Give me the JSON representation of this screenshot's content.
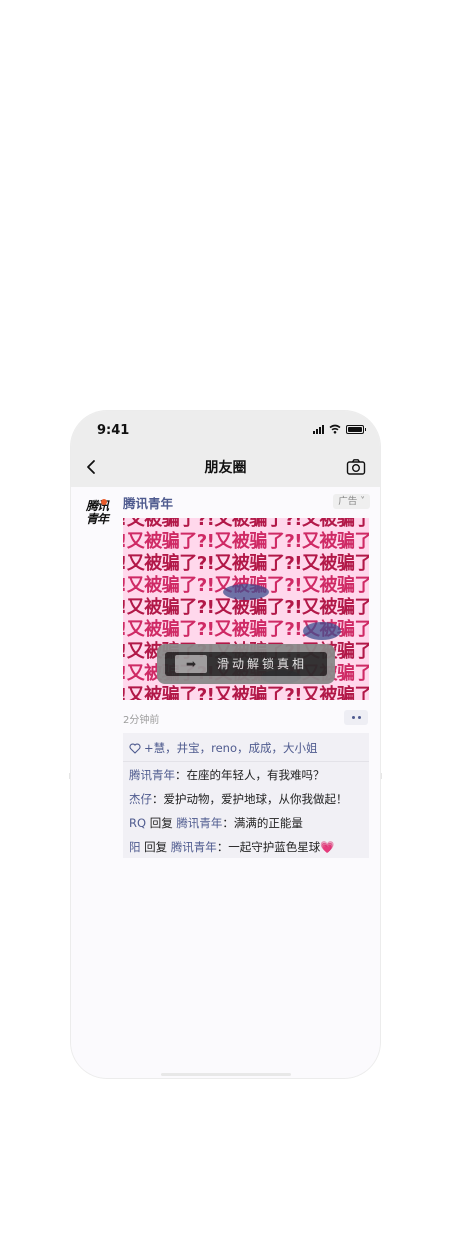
{
  "status_bar": {
    "time": "9:41"
  },
  "navbar": {
    "title": "朋友圈"
  },
  "post": {
    "author": "腾讯青年",
    "avatar_lines": [
      "腾讯",
      "青年"
    ],
    "ad_label": "广告",
    "ad_image": {
      "repeated_text": "!又被骗了?!又被骗了?!又被骗了?!又被骗",
      "slide_button_label": "滑动解锁真相"
    },
    "timestamp": "2分钟前"
  },
  "comments": {
    "likes": "+慧，井宝，reno，成成，大小姐",
    "items": [
      {
        "author": "腾讯青年",
        "text": "：在座的年轻人，有我难吗？"
      },
      {
        "author": "杰仔",
        "text": "：爱护动物，爱护地球，从你我做起！"
      },
      {
        "author": "RQ",
        "reply_word": "回复",
        "reply_to": "腾讯青年",
        "text": "：满满的正能量"
      },
      {
        "author": "阳",
        "reply_word": "回复",
        "reply_to": "腾讯青年",
        "text": "：一起守护蓝色星球",
        "emoji": "💗"
      }
    ]
  },
  "colors": {
    "link": "#4f5b8f",
    "ad_text": "#b21848",
    "ad_bg": "#ffd8ec"
  }
}
